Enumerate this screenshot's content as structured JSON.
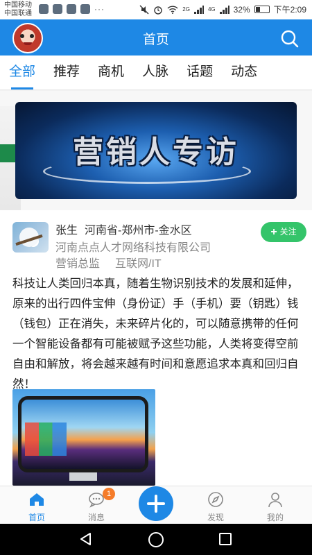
{
  "status_bar": {
    "carrier_1": "中国移动",
    "carrier_2": "中国联通",
    "dots": "···",
    "signal_labels": [
      "2G",
      "4G"
    ],
    "battery": "32%",
    "battery_level": 0.32,
    "time": "下午2:09"
  },
  "header": {
    "title": "首页"
  },
  "tabs": [
    {
      "label": "全部",
      "active": true
    },
    {
      "label": "推荐",
      "active": false
    },
    {
      "label": "商机",
      "active": false
    },
    {
      "label": "人脉",
      "active": false
    },
    {
      "label": "话题",
      "active": false
    },
    {
      "label": "动态",
      "active": false
    }
  ],
  "banner": {
    "text": "营销人专访"
  },
  "post": {
    "user_name": "张生",
    "location": "河南省-郑州市-金水区",
    "company": "河南点点人才网络科技有限公司",
    "position": "营销总监",
    "industry": "互联网/IT",
    "follow_label": "关注",
    "content": "科技让人类回归本真，随着生物识别技术的发展和延伸，原来的出行四件宝伸（身份证）手（手机）要（钥匙）钱（钱包）正在消失，未来碎片化的，可以随意携带的任何一个智能设备都有可能被赋予这些功能，人类将变得空前自由和解放，将会越来越有时间和意愿追求本真和回归自然！"
  },
  "bottom_nav": {
    "items": [
      {
        "label": "首页",
        "icon": "home-icon",
        "active": true
      },
      {
        "label": "消息",
        "icon": "chat-icon",
        "badge": "1"
      },
      {
        "label": "",
        "icon": "plus-icon"
      },
      {
        "label": "发现",
        "icon": "compass-icon"
      },
      {
        "label": "我的",
        "icon": "user-icon"
      }
    ]
  },
  "colors": {
    "primary": "#1e88e5",
    "follow_green": "#34c46a",
    "badge_orange": "#f57c2a"
  }
}
